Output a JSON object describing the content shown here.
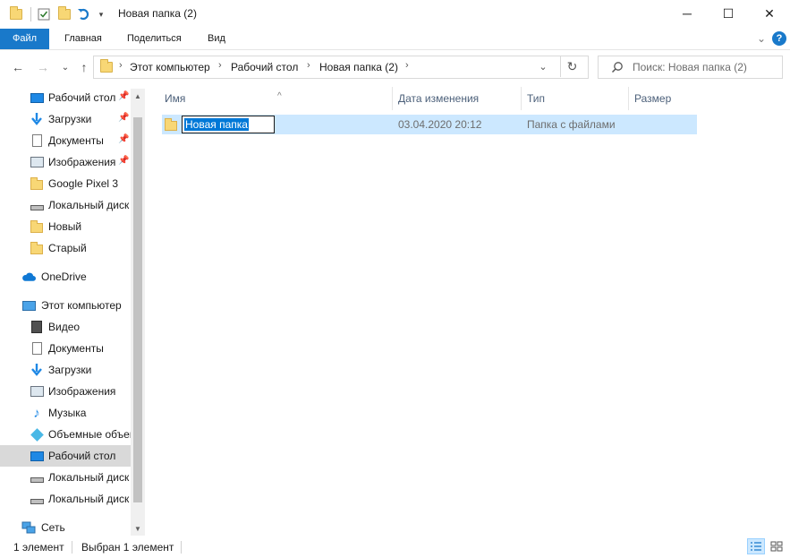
{
  "window": {
    "title": "Новая папка (2)",
    "minimize_glyph": "─",
    "maximize_glyph": "☐",
    "close_glyph": "✕"
  },
  "ribbon": {
    "tabs": [
      "Файл",
      "Главная",
      "Поделиться",
      "Вид"
    ],
    "collapse_glyph": "⌄",
    "help_glyph": "?"
  },
  "navigation": {
    "back_glyph": "←",
    "forward_glyph": "→",
    "recent_glyph": "⌄",
    "up_glyph": "↑"
  },
  "address": {
    "crumbs": [
      "Этот компьютер",
      "Рабочий стол",
      "Новая папка (2)"
    ],
    "separator": "›",
    "dropdown_glyph": "⌄",
    "refresh_glyph": "↻"
  },
  "search": {
    "placeholder": "Поиск: Новая папка (2)"
  },
  "nav_pane": {
    "quick_access": [
      {
        "label": "Рабочий стол",
        "icon": "desktop-icon",
        "pinned": true
      },
      {
        "label": "Загрузки",
        "icon": "downloads-icon",
        "pinned": true
      },
      {
        "label": "Документы",
        "icon": "documents-icon",
        "pinned": true
      },
      {
        "label": "Изображения",
        "icon": "pictures-icon",
        "pinned": true
      },
      {
        "label": "Google Pixel 3",
        "icon": "folder-icon",
        "pinned": false
      },
      {
        "label": "Локальный диск",
        "icon": "drive-icon",
        "pinned": false
      },
      {
        "label": "Новый",
        "icon": "folder-icon",
        "pinned": false
      },
      {
        "label": "Старый",
        "icon": "folder-icon",
        "pinned": false
      }
    ],
    "onedrive": "OneDrive",
    "this_pc": "Этот компьютер",
    "pc_items": [
      {
        "label": "Видео",
        "icon": "video-icon"
      },
      {
        "label": "Документы",
        "icon": "documents-icon"
      },
      {
        "label": "Загрузки",
        "icon": "downloads-icon"
      },
      {
        "label": "Изображения",
        "icon": "pictures-icon"
      },
      {
        "label": "Музыка",
        "icon": "music-icon"
      },
      {
        "label": "Объемные объекты",
        "icon": "3d-objects-icon"
      },
      {
        "label": "Рабочий стол",
        "icon": "desktop-icon",
        "selected": true
      },
      {
        "label": "Локальный диск",
        "icon": "drive-icon"
      },
      {
        "label": "Локальный диск",
        "icon": "drive-icon"
      }
    ],
    "network": "Сеть",
    "pin_glyph": "📌"
  },
  "columns": [
    "Имя",
    "Дата изменения",
    "Тип",
    "Размер"
  ],
  "sort_glyph": "^",
  "files": [
    {
      "name": "Новая папка",
      "modified": "03.04.2020 20:12",
      "type": "Папка с файлами",
      "size": ""
    }
  ],
  "status": {
    "count": "1 элемент",
    "selected": "Выбран 1 элемент"
  },
  "colors": {
    "accent": "#1979ca",
    "selection": "#cce8ff",
    "rename_highlight": "#0078d7"
  }
}
